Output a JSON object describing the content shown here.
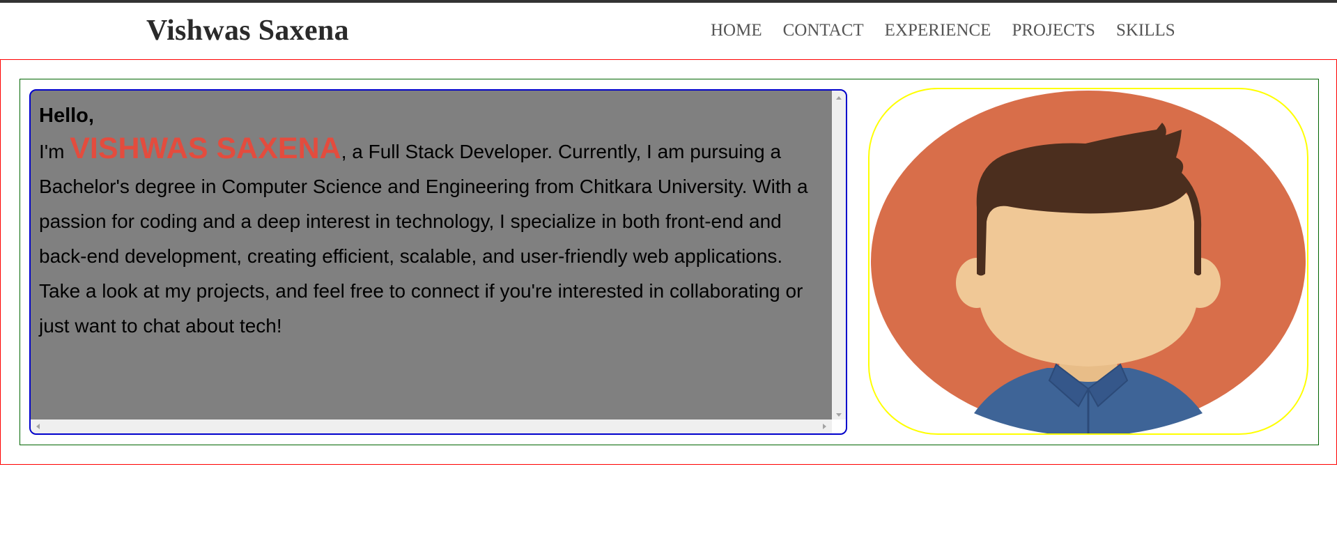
{
  "header": {
    "brand": "Vishwas Saxena",
    "nav": [
      "HOME",
      "CONTACT",
      "EXPERIENCE",
      "PROJECTS",
      "SKILLS"
    ]
  },
  "intro": {
    "greeting": "Hello,",
    "prefix": "I'm ",
    "name": "VISHWAS SAXENA",
    "body": ", a Full Stack Developer. Currently, I am pursuing a Bachelor's degree in Computer Science and Engineering from Chitkara University. With a passion for coding and a deep interest in technology, I specialize in both front-end and back-end development, creating efficient, scalable, and user-friendly web applications. Take a look at my projects, and feel free to connect if you're interested in collaborating or just want to chat about tech!"
  },
  "avatar": {
    "icon": "person-avatar-icon"
  },
  "colors": {
    "name_accent": "#e34c3e",
    "panel_bg": "#808080",
    "avatar_bg": "#d86e4a",
    "hair": "#4b2e1e",
    "skin": "#f0c896",
    "shirt": "#3e6497"
  }
}
